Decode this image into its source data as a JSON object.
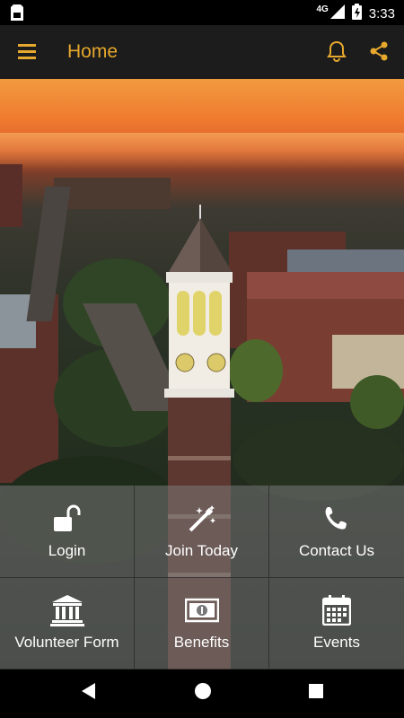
{
  "status_bar": {
    "time": "3:33",
    "network": "4G"
  },
  "app_bar": {
    "title": "Home"
  },
  "menu_tiles": [
    {
      "label": "Login",
      "icon": "unlock-icon"
    },
    {
      "label": "Join Today",
      "icon": "magic-wand-icon"
    },
    {
      "label": "Contact Us",
      "icon": "phone-icon"
    },
    {
      "label": "Volunteer Form",
      "icon": "institution-icon"
    },
    {
      "label": "Benefits",
      "icon": "money-bill-icon"
    },
    {
      "label": "Events",
      "icon": "calendar-icon"
    }
  ],
  "colors": {
    "accent": "#e6a82d",
    "app_bar_bg": "#1c1c1c",
    "tile_bg": "rgba(120,120,120,0.55)"
  }
}
